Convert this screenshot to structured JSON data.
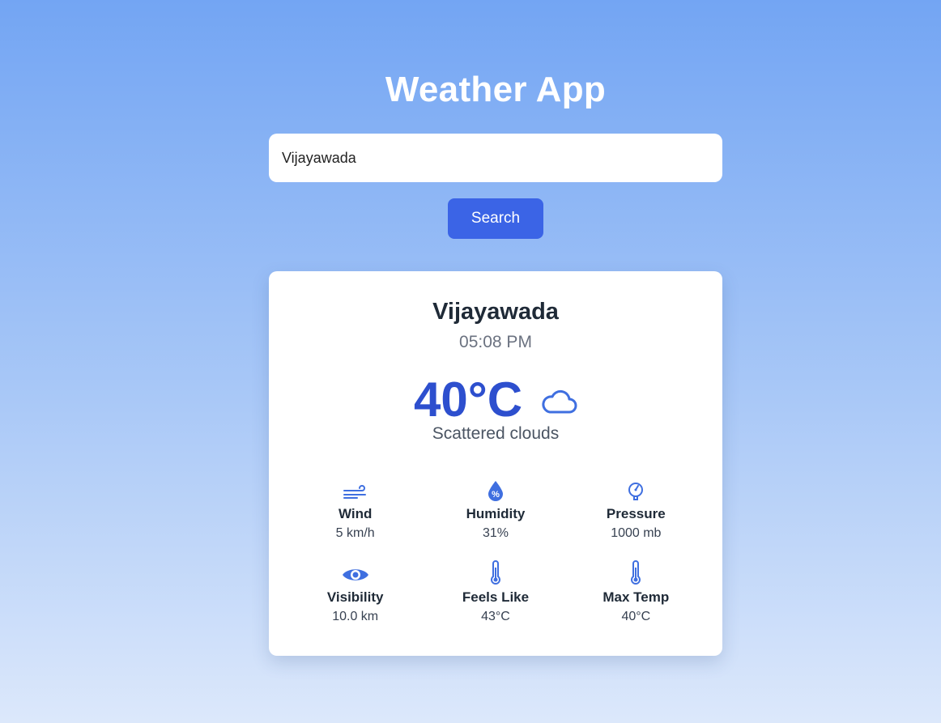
{
  "app": {
    "title": "Weather App"
  },
  "search": {
    "value": "Vijayawada",
    "button_label": "Search"
  },
  "weather": {
    "city": "Vijayawada",
    "time": "05:08 PM",
    "temperature": "40°C",
    "condition_icon": "cloud-icon",
    "description": "Scattered clouds",
    "details": [
      {
        "label": "Wind",
        "value": "5 km/h",
        "icon": "wind-icon"
      },
      {
        "label": "Humidity",
        "value": "31%",
        "icon": "humidity-icon"
      },
      {
        "label": "Pressure",
        "value": "1000 mb",
        "icon": "pressure-gauge-icon"
      },
      {
        "label": "Visibility",
        "value": "10.0 km",
        "icon": "eye-icon"
      },
      {
        "label": "Feels Like",
        "value": "43°C",
        "icon": "thermometer-icon"
      },
      {
        "label": "Max Temp",
        "value": "40°C",
        "icon": "thermometer-icon"
      }
    ]
  },
  "colors": {
    "accent": "#3b64e6",
    "temperature": "#2d4fce",
    "icon": "#3f6fe0"
  }
}
